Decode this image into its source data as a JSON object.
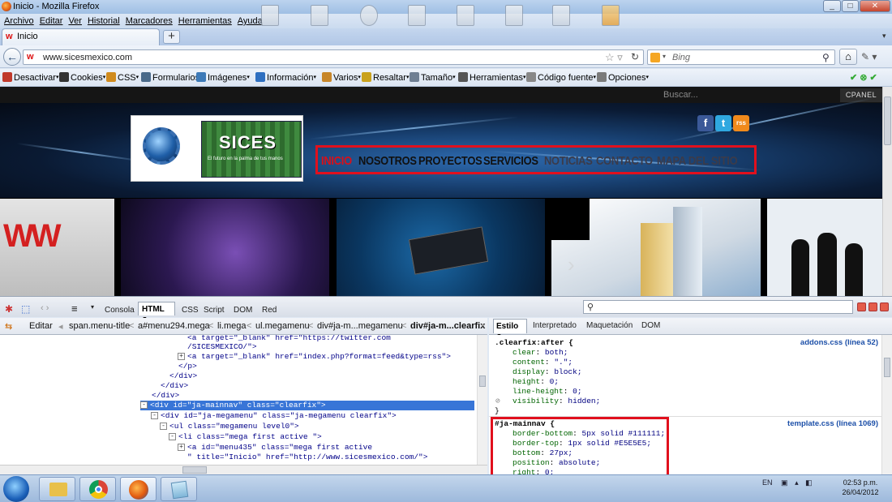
{
  "window": {
    "title": "Inicio - Mozilla Firefox",
    "buttons": [
      "_",
      "□",
      "✕"
    ]
  },
  "menubar": [
    "Archivo",
    "Editar",
    "Ver",
    "Historial",
    "Marcadores",
    "Herramientas",
    "Ayuda"
  ],
  "tab": {
    "label": "Inicio",
    "new_tab": "+",
    "list": "▾"
  },
  "nav": {
    "back": "←",
    "url": "www.sicesmexico.com",
    "search_placeholder": "Bing",
    "home": "⌂"
  },
  "devtoolbar": [
    {
      "label": "Desactivar",
      "icon": "forbidden-icon"
    },
    {
      "label": "Cookies",
      "icon": "user-icon"
    },
    {
      "label": "CSS",
      "icon": "pencil-icon"
    },
    {
      "label": "Formularios",
      "icon": "form-icon"
    },
    {
      "label": "Imágenes",
      "icon": "image-icon"
    },
    {
      "label": "Información",
      "icon": "info-icon"
    },
    {
      "label": "Varios",
      "icon": "folder-icon"
    },
    {
      "label": "Resaltar",
      "icon": "pencil-icon"
    },
    {
      "label": "Tamaño",
      "icon": "resize-icon"
    },
    {
      "label": "Herramientas",
      "icon": "tools-icon"
    },
    {
      "label": "Código fuente",
      "icon": "source-icon"
    },
    {
      "label": "Opciones",
      "icon": "options-icon"
    }
  ],
  "site": {
    "search_label": "Buscar...",
    "cpanel": "CPANEL",
    "logo_name": "SICES",
    "logo_tagline": "El futuro en la palma de tus manos",
    "social": [
      "f",
      "t",
      "rss"
    ],
    "nav": [
      "INICIO",
      "NOSOTROS",
      "PROYECTOS",
      "SERVICIOS",
      "NOTICIAS",
      "CONTACTO",
      "MAPA DEL SITIO"
    ],
    "next_arrow": "›"
  },
  "firebug": {
    "tabs": [
      "Consola",
      "HTML",
      "CSS",
      "Script",
      "DOM",
      "Red"
    ],
    "active_tab": "HTML",
    "edit_label": "Editar",
    "breadcrumbs": [
      "span.menu-title",
      "a#menu294.mega",
      "li.mega",
      "ul.megamenu",
      "div#ja-m...megamenu",
      "div#ja-m...clearfix"
    ],
    "side_tabs": [
      "Estilo",
      "Interpretado",
      "Maquetación",
      "DOM"
    ],
    "active_side_tab": "Estilo",
    "html_lines": [
      {
        "indent": 4,
        "exp": "",
        "text": "<a target=\"_blank\" href=\"https://twitter.com",
        "cut": true
      },
      {
        "indent": 4,
        "exp": "",
        "text": "/SICESMEXICO/\">"
      },
      {
        "indent": 4,
        "exp": "+",
        "text": "<a target=\"_blank\" href=\"index.php?format=feed&type=rss\">"
      },
      {
        "indent": 3,
        "exp": "",
        "text": "</p>"
      },
      {
        "indent": 2,
        "exp": "",
        "text": "</div>"
      },
      {
        "indent": 1,
        "exp": "",
        "text": "</div>"
      },
      {
        "indent": 0,
        "exp": "",
        "text": "</div>"
      },
      {
        "indent": 0,
        "exp": "-",
        "text": "<div id=\"ja-mainnav\" class=\"clearfix\">",
        "selected": true
      },
      {
        "indent": 1,
        "exp": "-",
        "text": "<div id=\"ja-megamenu\" class=\"ja-megamenu clearfix\">"
      },
      {
        "indent": 2,
        "exp": "-",
        "text": "<ul class=\"megamenu level0\">"
      },
      {
        "indent": 3,
        "exp": "-",
        "text": "<li class=\"mega first active \">"
      },
      {
        "indent": 4,
        "exp": "+",
        "text": "<a id=\"menu435\" class=\"mega first active"
      },
      {
        "indent": 4,
        "exp": "",
        "text": "\" title=\"Inicio\" href=\"http://www.sicesmexico.com/\">"
      }
    ],
    "css_rules": [
      {
        "selector": ".clearfix:after {",
        "source": "addons.css (línea 52)",
        "props": [
          [
            "clear",
            "both;"
          ],
          [
            "content",
            "\".\";"
          ],
          [
            "display",
            "block;"
          ],
          [
            "height",
            "0;"
          ],
          [
            "line-height",
            "0;"
          ],
          [
            "visibility",
            "hidden;"
          ]
        ]
      },
      {
        "selector": "#ja-mainnav {",
        "source": "template.css (línea 1069)",
        "props": [
          [
            "border-bottom",
            "5px solid #111111;"
          ],
          [
            "border-top",
            "1px solid #E5E5E5;"
          ],
          [
            "bottom",
            "27px;"
          ],
          [
            "position",
            "absolute;"
          ],
          [
            "right",
            "0;"
          ]
        ]
      }
    ]
  },
  "taskbar": {
    "lang": "EN",
    "time": "02:53 p.m.",
    "date": "26/04/2012"
  }
}
